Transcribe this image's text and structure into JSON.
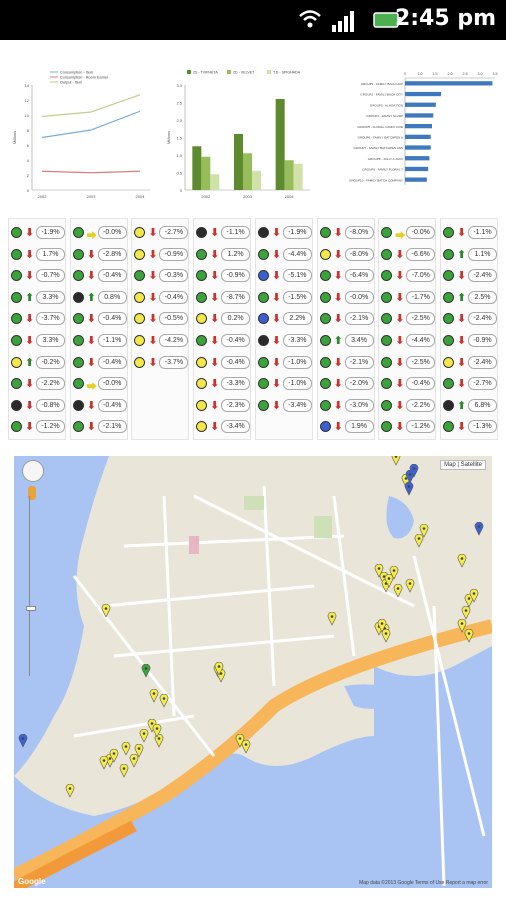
{
  "status": {
    "time": "2:45 pm",
    "icons": [
      "wifi-icon",
      "signal-icon",
      "battery-icon"
    ]
  },
  "chart_data": [
    {
      "type": "line",
      "legend": [
        "Consumption - Item",
        "Consumption - Room Earner",
        "Output - Item"
      ],
      "x": [
        "2002",
        "2003",
        "2004"
      ],
      "ylim": [
        0,
        14
      ],
      "yticks": [
        "0",
        "2",
        "4",
        "6",
        "8",
        "10",
        "12",
        "14"
      ],
      "ylabel": "Millions",
      "series": [
        {
          "name": "Consumption - Item",
          "values": [
            7,
            8,
            10.5
          ],
          "color": "#7aaed6"
        },
        {
          "name": "Consumption - Room Earner",
          "values": [
            2.5,
            2.3,
            2.5
          ],
          "color": "#d87c7c"
        },
        {
          "name": "Output - Item",
          "values": [
            9.8,
            10.4,
            12.7
          ],
          "color": "#c7cc8e"
        }
      ]
    },
    {
      "type": "bar",
      "legend": [
        "2S - TVIPHETA",
        "2D - VELVET",
        "T.D - SPIGHADA"
      ],
      "categories": [
        "2002",
        "2003",
        "2004"
      ],
      "ylim": [
        0,
        3.0
      ],
      "yticks": [
        "0",
        "0.5",
        "1.0",
        "1.5",
        "2.0",
        "2.5",
        "3.0"
      ],
      "ylabel": "Millions",
      "series": [
        {
          "name": "2S - TVIPHETA",
          "values": [
            1.25,
            1.6,
            2.6
          ],
          "color": "#5d8a2e"
        },
        {
          "name": "2D - VELVET",
          "values": [
            0.95,
            1.05,
            0.85
          ],
          "color": "#97bd5b"
        },
        {
          "name": "T.D - SPIGHADA",
          "values": [
            0.45,
            0.55,
            0.75
          ],
          "color": "#cfe3a8"
        }
      ]
    },
    {
      "type": "bar",
      "orientation": "horizontal",
      "xticks": [
        "0",
        "1.0",
        "1.5",
        "2.0",
        "2.5",
        "3.0",
        "3.5"
      ],
      "xlim": [
        0,
        3.5
      ],
      "categories": [
        "GROUP1 - FAMILY BACH HOP",
        "GROUP2 - FAMILY BACH CITY",
        "GROUP3 - ALHOA TION",
        "GROUP4 - FAMILY SLURP",
        "GROUP5 - FLORAL CANDY FIVE",
        "GROUP6 - FAMILY BATCHPEN A",
        "GROUP7 - FAMILY BATCHPEN ANS",
        "GROUP8 - JOLLY A JACK",
        "GROUP9 - FAMILY FLORAL T",
        "GROUP10 - FAMILY BATCH COMPANY"
      ],
      "values": [
        3.4,
        1.4,
        1.2,
        1.1,
        1.05,
        1.0,
        1.0,
        0.95,
        0.9,
        0.85
      ],
      "color": "#3f79bd"
    }
  ],
  "grid": {
    "columns": [
      [
        [
          "green",
          "down",
          "-1.9%"
        ],
        [
          "green",
          "down",
          "1.7%"
        ],
        [
          "green",
          "down",
          "-0.7%"
        ],
        [
          "green",
          "up",
          "3.3%"
        ],
        [
          "green",
          "down",
          "-3.7%"
        ],
        [
          "green",
          "down",
          "3.3%"
        ],
        [
          "yellow",
          "up",
          "-0.2%"
        ],
        [
          "green",
          "down",
          "-2.2%"
        ],
        [
          "black",
          "down",
          "-0.8%"
        ],
        [
          "green",
          "down",
          "-1.2%"
        ]
      ],
      [
        [
          "green",
          "flat",
          "-0.0%"
        ],
        [
          "green",
          "down",
          "-2.8%"
        ],
        [
          "green",
          "down",
          "-0.4%"
        ],
        [
          "black",
          "up",
          "0.8%"
        ],
        [
          "green",
          "down",
          "-0.4%"
        ],
        [
          "green",
          "down",
          "-1.1%"
        ],
        [
          "green",
          "down",
          "-0.4%"
        ],
        [
          "green",
          "flat",
          "-0.0%"
        ],
        [
          "black",
          "down",
          "-0.4%"
        ],
        [
          "green",
          "down",
          "-2.1%"
        ]
      ],
      [
        [
          "yellow",
          "down",
          "-2.7%"
        ],
        [
          "yellow",
          "down",
          "-0.9%"
        ],
        [
          "green",
          "down",
          "-0.3%"
        ],
        [
          "yellow",
          "down",
          "-0.4%"
        ],
        [
          "yellow",
          "down",
          "-0.5%"
        ],
        [
          "yellow",
          "down",
          "-4.2%"
        ],
        [
          "yellow",
          "down",
          "-3.7%"
        ]
      ],
      [
        [
          "black",
          "down",
          "-1.1%"
        ],
        [
          "green",
          "down",
          "1.2%"
        ],
        [
          "green",
          "down",
          "-0.9%"
        ],
        [
          "green",
          "down",
          "-8.7%"
        ],
        [
          "yellow",
          "down",
          "0.2%"
        ],
        [
          "green",
          "down",
          "-0.4%"
        ],
        [
          "yellow",
          "down",
          "-0.4%"
        ],
        [
          "yellow",
          "down",
          "-3.3%"
        ],
        [
          "yellow",
          "down",
          "-2.3%"
        ],
        [
          "yellow",
          "down",
          "-3.4%"
        ]
      ],
      [
        [
          "black",
          "down",
          "-1.9%"
        ],
        [
          "green",
          "down",
          "-4.4%"
        ],
        [
          "blue",
          "down",
          "-5.1%"
        ],
        [
          "green",
          "down",
          "-1.5%"
        ],
        [
          "blue",
          "down",
          "2.2%"
        ],
        [
          "black",
          "down",
          "-3.3%"
        ],
        [
          "green",
          "down",
          "-1.0%"
        ],
        [
          "green",
          "down",
          "-1.0%"
        ],
        [
          "green",
          "down",
          "-3.4%"
        ]
      ],
      [
        [
          "green",
          "down",
          "-8.0%"
        ],
        [
          "yellow",
          "down",
          "-8.0%"
        ],
        [
          "green",
          "down",
          "-6.4%"
        ],
        [
          "green",
          "down",
          "-0.0%"
        ],
        [
          "green",
          "down",
          "-2.1%"
        ],
        [
          "green",
          "up",
          "3.4%"
        ],
        [
          "green",
          "down",
          "-2.1%"
        ],
        [
          "green",
          "down",
          "-2.0%"
        ],
        [
          "green",
          "down",
          "-3.0%"
        ],
        [
          "blue",
          "down",
          "1.9%"
        ]
      ],
      [
        [
          "green",
          "flat",
          "-0.0%"
        ],
        [
          "green",
          "down",
          "-6.6%"
        ],
        [
          "green",
          "down",
          "-7.0%"
        ],
        [
          "green",
          "down",
          "-1.7%"
        ],
        [
          "green",
          "down",
          "-2.5%"
        ],
        [
          "green",
          "down",
          "-4.4%"
        ],
        [
          "green",
          "down",
          "-2.5%"
        ],
        [
          "green",
          "down",
          "-0.4%"
        ],
        [
          "green",
          "down",
          "-2.2%"
        ],
        [
          "green",
          "down",
          "-1.2%"
        ]
      ],
      [
        [
          "green",
          "down",
          "-1.1%"
        ],
        [
          "green",
          "up",
          "1.1%"
        ],
        [
          "green",
          "down",
          "-2.4%"
        ],
        [
          "green",
          "up",
          "2.5%"
        ],
        [
          "green",
          "down",
          "-2.4%"
        ],
        [
          "green",
          "down",
          "-0.9%"
        ],
        [
          "yellow",
          "down",
          "-2.4%"
        ],
        [
          "green",
          "down",
          "-2.7%"
        ],
        [
          "black",
          "up",
          "6.8%"
        ],
        [
          "green",
          "down",
          "-1.3%"
        ]
      ]
    ]
  },
  "map": {
    "map_button": "Map",
    "satellite_button": "Satellite",
    "brand": "Google",
    "footer": "Map data ©2013 Google   Terms of Use   Report a map error",
    "pins": [
      {
        "color": "yellow",
        "count": 42
      },
      {
        "color": "blue",
        "count": 4
      },
      {
        "color": "green",
        "count": 1
      }
    ]
  },
  "colors": {
    "green": "#3aa43a",
    "yellow": "#f2e84a",
    "black": "#2a2a2a",
    "blue": "#3a5fd0",
    "down": "#d0302a",
    "up": "#2a8a2a",
    "flat": "#e8d020"
  }
}
